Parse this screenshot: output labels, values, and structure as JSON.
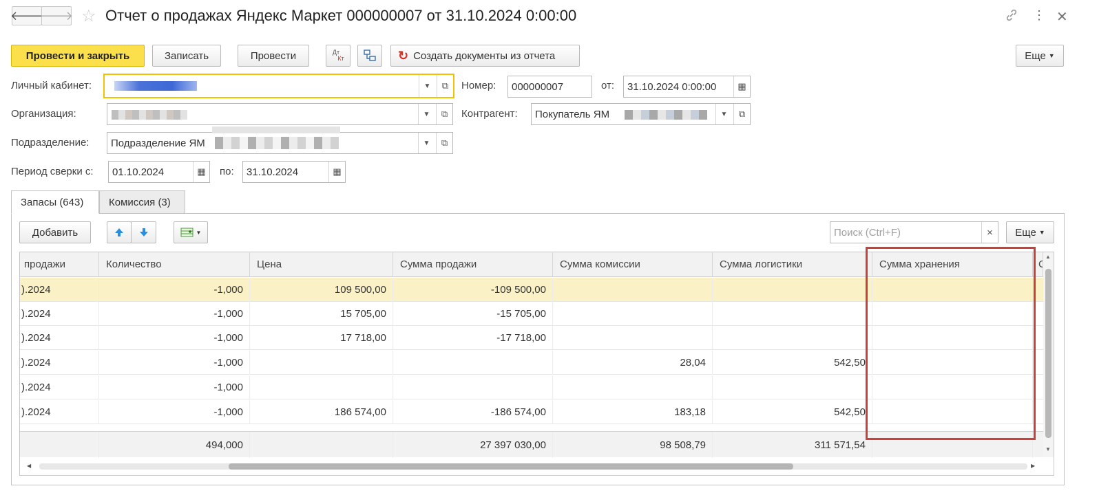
{
  "header": {
    "title": "Отчет о продажах Яндекс Маркет 000000007 от 31.10.2024 0:00:00",
    "back_icon": "arrow-left-icon",
    "forward_icon": "arrow-right-icon",
    "star_icon": "star-icon",
    "link_icon": "link-icon",
    "more_icon": "more-vertical-icon",
    "close_icon": "close-icon"
  },
  "toolbar": {
    "post_close": "Провести и закрыть",
    "save": "Записать",
    "post": "Провести",
    "dt_kt_top": "Дт",
    "dt_kt_bottom": "Кт",
    "create_docs": "Создать документы из отчета",
    "more": "Еще"
  },
  "form": {
    "cabinet_label": "Личный кабинет:",
    "org_label": "Организация:",
    "division_label": "Подразделение:",
    "division_value": "Подразделение ЯМ",
    "period_label": "Период сверки с:",
    "period_from": "01.10.2024",
    "period_to_label": "по:",
    "period_to": "31.10.2024",
    "number_label": "Номер:",
    "number_value": "000000007",
    "date_label": "от:",
    "date_value": "31.10.2024  0:00:00",
    "counterparty_label": "Контрагент:",
    "counterparty_value": "Покупатель ЯМ"
  },
  "tabs": [
    {
      "label": "Запасы (643)",
      "active": true
    },
    {
      "label": "Комиссия (3)",
      "active": false
    }
  ],
  "table_toolbar": {
    "add": "Добавить",
    "search_placeholder": "Поиск (Ctrl+F)",
    "clear": "×",
    "more": "Еще"
  },
  "table": {
    "columns": [
      "продажи",
      "Количество",
      "Цена",
      "Сумма продажи",
      "Сумма комиссии",
      "Сумма логистики",
      "Сумма хранения",
      "С"
    ],
    "rows": [
      [
        ").2024",
        "-1,000",
        "109 500,00",
        "-109 500,00",
        "",
        "",
        ""
      ],
      [
        ").2024",
        "-1,000",
        "15 705,00",
        "-15 705,00",
        "",
        "",
        ""
      ],
      [
        ").2024",
        "-1,000",
        "17 718,00",
        "-17 718,00",
        "",
        "",
        ""
      ],
      [
        ").2024",
        "-1,000",
        "",
        "",
        "28,04",
        "542,50",
        ""
      ],
      [
        ").2024",
        "-1,000",
        "",
        "",
        "",
        "",
        ""
      ],
      [
        ").2024",
        "-1,000",
        "186 574,00",
        "-186 574,00",
        "183,18",
        "542,50",
        ""
      ]
    ],
    "totals": [
      "",
      "494,000",
      "",
      "27 397 030,00",
      "98 508,79",
      "311 571,54",
      ""
    ]
  },
  "colors": {
    "primary_button": "#fbe04b",
    "selected_row": "#fbf1c7",
    "highlight_box": "#c9403a",
    "refresh_icon": "#d93025",
    "arrow_blue": "#2a8ee0"
  }
}
